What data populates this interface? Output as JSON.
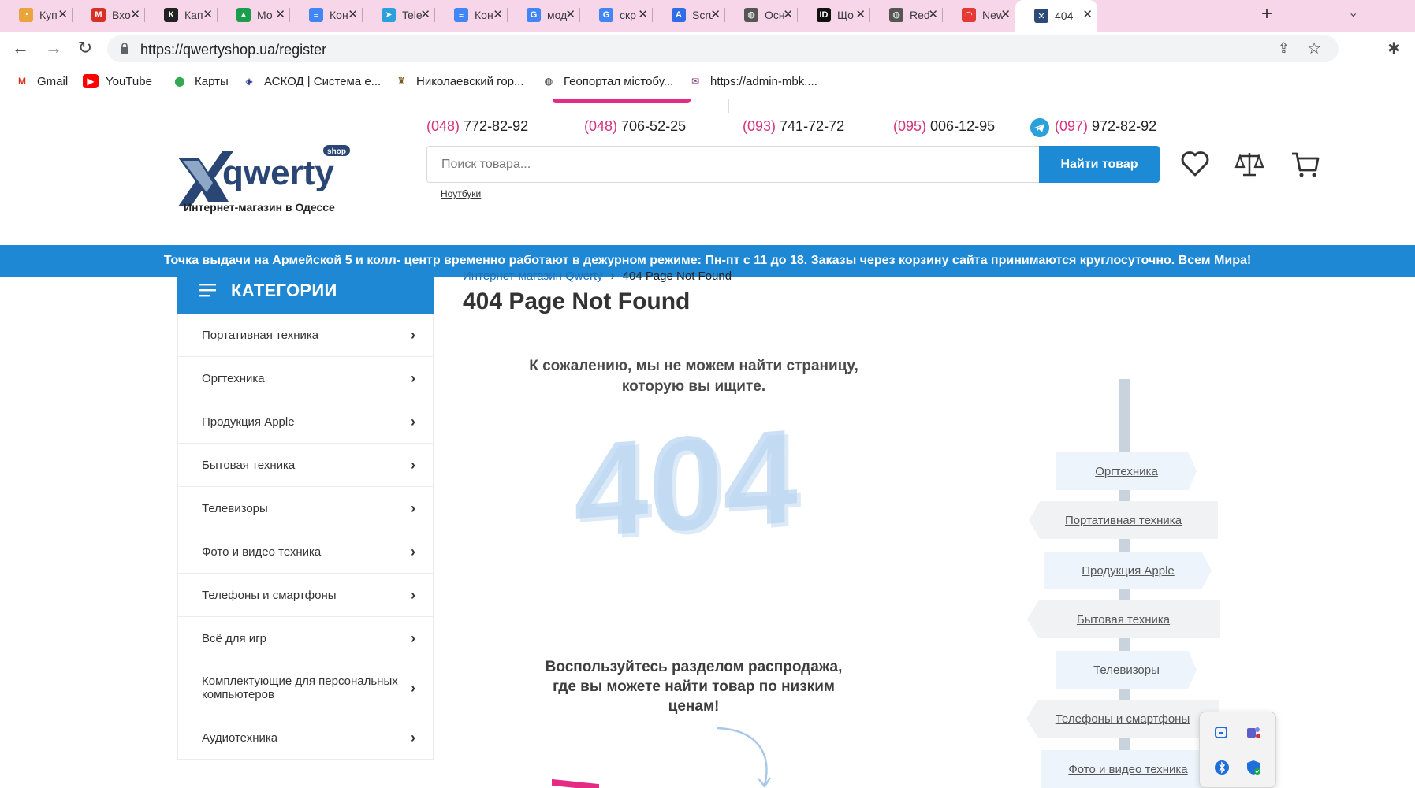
{
  "browser": {
    "tabs": [
      {
        "title": "Куп",
        "color": "#e9a43b",
        "glyph": "◔"
      },
      {
        "title": "Вхо",
        "color": "#d93025",
        "glyph": "M"
      },
      {
        "title": "Кап",
        "color": "#222222",
        "glyph": "К"
      },
      {
        "title": "Мо",
        "color": "#1a9e4b",
        "glyph": "▲"
      },
      {
        "title": "Кон",
        "color": "#4285f4",
        "glyph": "≡"
      },
      {
        "title": "Tele",
        "color": "#2aa1da",
        "glyph": "➤"
      },
      {
        "title": "Кон",
        "color": "#4285f4",
        "glyph": "≡"
      },
      {
        "title": "мод",
        "color": "#4285f4",
        "glyph": "G"
      },
      {
        "title": "скр",
        "color": "#4285f4",
        "glyph": "G"
      },
      {
        "title": "Scru",
        "color": "#2f6ce5",
        "glyph": "A"
      },
      {
        "title": "Осн",
        "color": "#555555",
        "glyph": "◍"
      },
      {
        "title": "Що",
        "color": "#111111",
        "glyph": "ID"
      },
      {
        "title": "Red",
        "color": "#555555",
        "glyph": "◍"
      },
      {
        "title": "New",
        "color": "#e53935",
        "glyph": "◠"
      },
      {
        "title": "404",
        "color": "#2c4a78",
        "glyph": "✕"
      }
    ],
    "url": "https://qwertyshop.ua/register",
    "bookmarks": [
      {
        "label": "Gmail",
        "icon": "gmail-icon"
      },
      {
        "label": "YouTube",
        "icon": "youtube-icon"
      },
      {
        "label": "Карты",
        "icon": "maps-icon"
      },
      {
        "label": "АСКОД | Система е...",
        "icon": "askod-icon"
      },
      {
        "label": "Николаевский гор...",
        "icon": "crest-icon"
      },
      {
        "label": "Геопортал містобу...",
        "icon": "globe-icon"
      },
      {
        "label": "https://admin-mbk....",
        "icon": "mail-icon"
      }
    ]
  },
  "header": {
    "logo_text": "qwerty",
    "logo_badge": "shop",
    "tagline": "Интернет-магазин в Одессе",
    "phones": [
      {
        "code": "(048)",
        "number": " 772-82-92"
      },
      {
        "code": "(048)",
        "number": " 706-52-25"
      },
      {
        "code": "(093)",
        "number": " 741-72-72"
      },
      {
        "code": "(095)",
        "number": " 006-12-95"
      },
      {
        "code": "(097)",
        "number": " 972-82-92"
      }
    ],
    "search_placeholder": "Поиск товара...",
    "search_button": "Найти товар",
    "search_hint": "Ноутбуки"
  },
  "banner": "Точка выдачи на Армейской 5 и колл- центр временно работают в дежурном режиме: Пн-пт с 11 до 18. Заказы через корзину сайта принимаются круглосуточно. Всем Мира!",
  "sidebar": {
    "title": "КАТЕГОРИИ",
    "items": [
      "Портативная техника",
      "Оргтехника",
      "Продукция Apple",
      "Бытовая техника",
      "Телевизоры",
      "Фото и видео техника",
      "Телефоны и смартфоны",
      "Всё для игр",
      "Комплектующие для персональных компьютеров",
      "Аудиотехника"
    ]
  },
  "main": {
    "breadcrumb_home": "Интернет-магазин Qwerty",
    "breadcrumb_current": "404 Page Not Found",
    "title": "404 Page Not Found",
    "sorry_text": "К сожалению, мы не можем найти страницу, которую вы ищите.",
    "big_code": "404",
    "sale_text": "Воспользуйтесь разделом распродажа, где вы можете найти товар по низким ценам!",
    "signposts": [
      "Оргтехника",
      "Портативная техника",
      "Продукция Apple",
      "Бытовая техника",
      "Телевизоры",
      "Телефоны и смартфоны",
      "Фото и видео техника"
    ]
  },
  "colors": {
    "accent_blue": "#1e88d4",
    "accent_pink": "#e52c84",
    "phone_code": "#d4337e"
  }
}
